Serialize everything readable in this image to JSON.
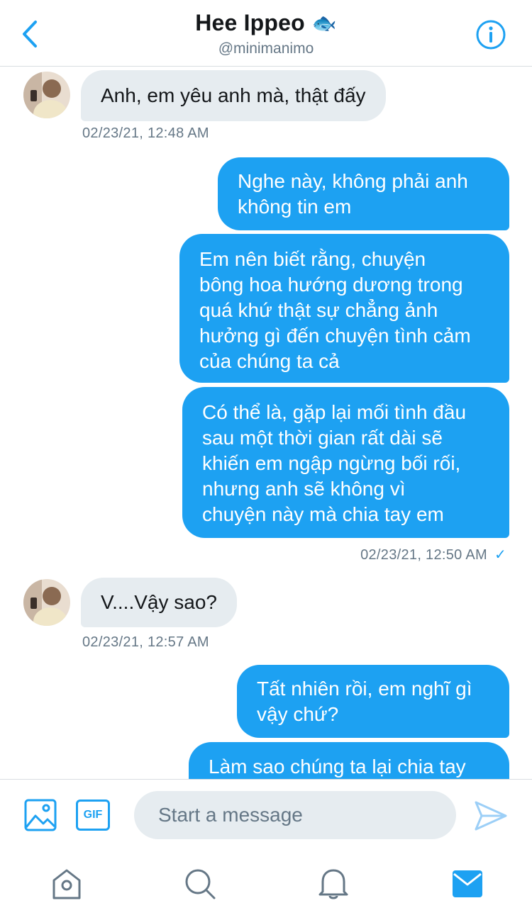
{
  "header": {
    "name": "Hee Ippeo",
    "emoji": "🐟",
    "handle": "@minimanimo"
  },
  "messages": [
    {
      "direction": "in",
      "text": "Anh, em yêu anh mà, thật đấy",
      "timestamp": "02/23/21, 12:48 AM"
    },
    {
      "direction": "out",
      "lines": [
        "Nghe này, không phải anh",
        "không tin em"
      ]
    },
    {
      "direction": "out",
      "lines": [
        "Em nên biết rằng, chuyện",
        "bông hoa hướng dương trong",
        "quá khứ thật sự chẳng ảnh",
        "hưởng gì đến chuyện tình cảm",
        "của chúng ta cả"
      ]
    },
    {
      "direction": "out",
      "lines": [
        "Có thể là, gặp lại mối tình đầu",
        "sau một thời gian rất dài sẽ",
        "khiến em ngập ngừng bối rối,",
        "nhưng anh sẽ không vì",
        "chuyện này mà chia tay em"
      ],
      "timestamp": "02/23/21, 12:50 AM",
      "read_check": "✓"
    },
    {
      "direction": "in",
      "text": "V....Vậy sao?",
      "timestamp": "02/23/21, 12:57 AM"
    },
    {
      "direction": "out",
      "lines": [
        "Tất nhiên rồi, em nghĩ gì",
        "vậy chứ?"
      ]
    },
    {
      "direction": "out",
      "lines": [
        "Làm sao chúng ta lại chia tay"
      ]
    }
  ],
  "composer": {
    "placeholder": "Start a message",
    "gif_label": "GIF"
  },
  "tabbar": {
    "items": [
      "home-icon",
      "search-icon",
      "bell-icon",
      "mail-icon"
    ],
    "active": "mail-icon"
  },
  "colors": {
    "accent": "#1da1f2",
    "incoming_bubble": "#e6ecf0",
    "muted_text": "#657786"
  }
}
